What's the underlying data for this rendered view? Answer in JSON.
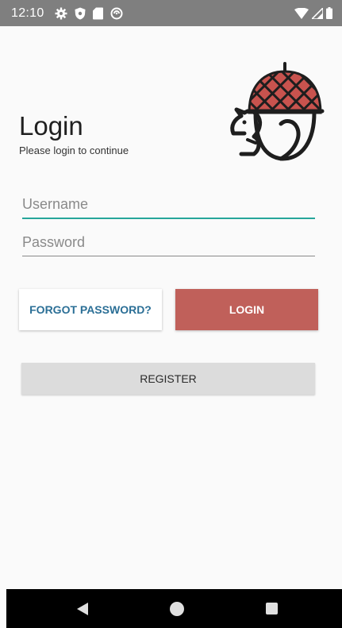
{
  "status_bar": {
    "time": "12:10",
    "icons": [
      "settings-icon",
      "shield-icon",
      "sd-card-icon",
      "sync-icon"
    ],
    "right_icons": [
      "wifi-icon",
      "signal-icon",
      "battery-icon"
    ]
  },
  "header": {
    "title": "Login",
    "subtitle": "Please login to continue",
    "logo_icon": "acorn-squirrel-icon"
  },
  "form": {
    "username_placeholder": "Username",
    "username_value": "",
    "password_placeholder": "Password",
    "password_value": ""
  },
  "buttons": {
    "forgot_label": "FORGOT PASSWORD?",
    "login_label": "LOGIN",
    "register_label": "REGISTER"
  },
  "colors": {
    "accent": "#26a69a",
    "login_button": "#c0605a",
    "forgot_text": "#2b6f96",
    "register_button": "#dcdcdc",
    "status_bar": "#7f7f7f"
  },
  "nav_bar": {
    "icons": [
      "back-icon",
      "home-icon",
      "recents-icon"
    ]
  }
}
